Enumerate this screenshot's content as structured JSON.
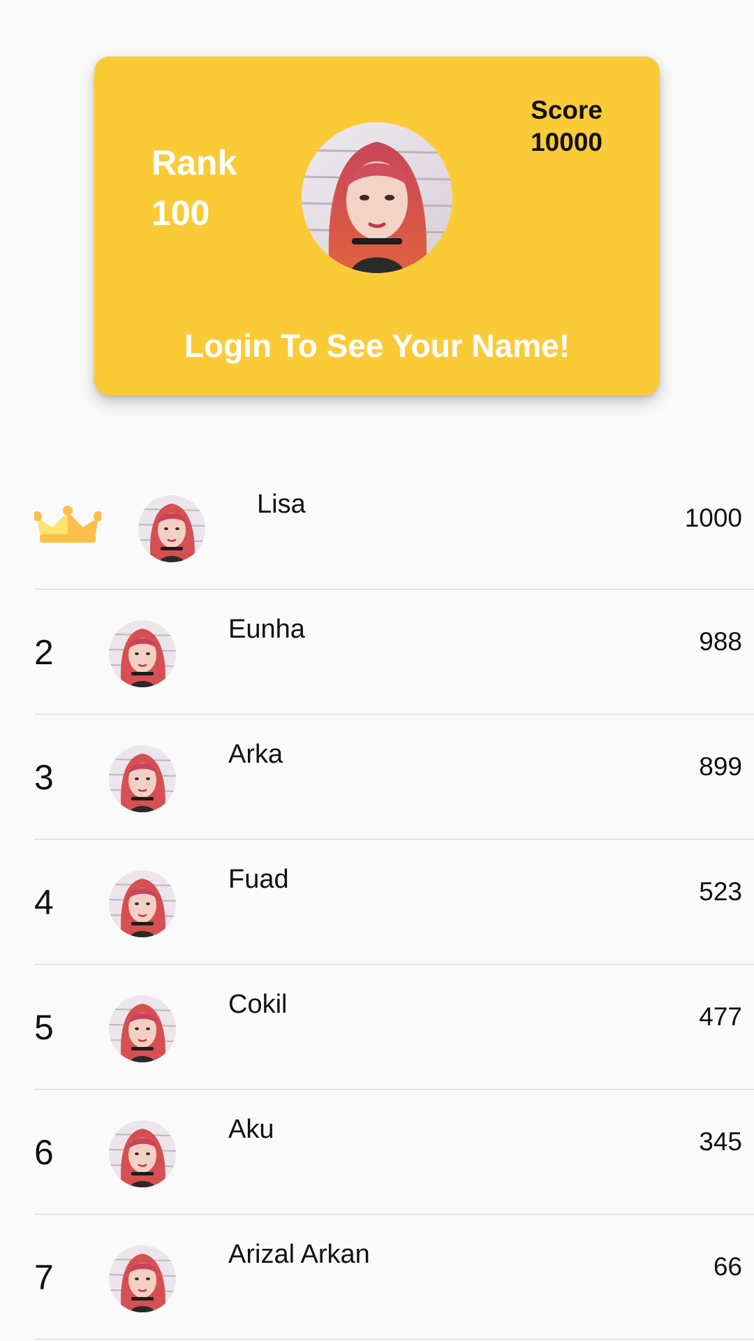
{
  "profile_card": {
    "rank_label": "Rank",
    "rank_value": "100",
    "score_label": "Score",
    "score_value": "10000",
    "login_prompt": "Login To See Your Name!",
    "accent_color": "#fbcb37"
  },
  "leaderboard": {
    "rows": [
      {
        "rank": "1",
        "badge": "crown-icon",
        "name": "Lisa",
        "score": "1000"
      },
      {
        "rank": "2",
        "name": "Eunha",
        "score": "988"
      },
      {
        "rank": "3",
        "name": "Arka",
        "score": "899"
      },
      {
        "rank": "4",
        "name": "Fuad",
        "score": "523"
      },
      {
        "rank": "5",
        "name": "Cokil",
        "score": "477"
      },
      {
        "rank": "6",
        "name": "Aku",
        "score": "345"
      },
      {
        "rank": "7",
        "name": "Arizal Arkan",
        "score": "66"
      }
    ]
  }
}
